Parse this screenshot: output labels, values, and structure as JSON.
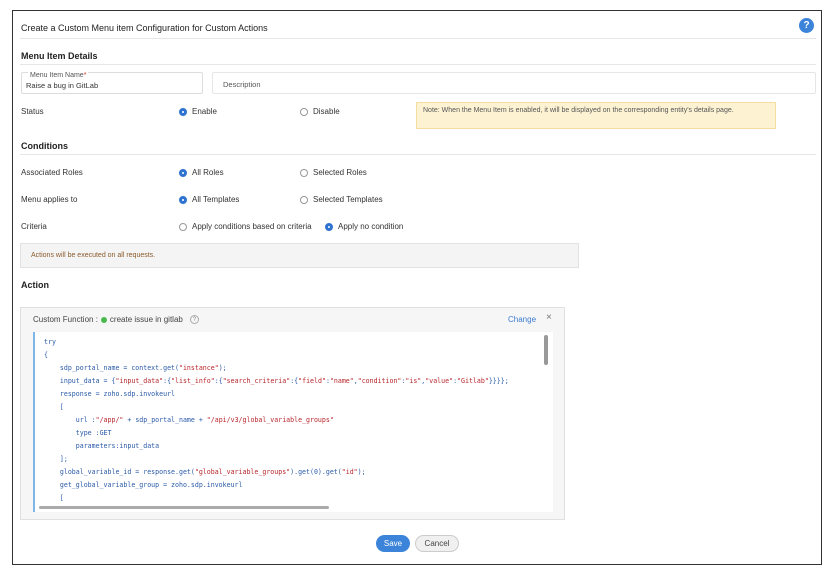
{
  "header": {
    "title": "Create a Custom Menu item Configuration for Custom Actions",
    "help_icon": "?"
  },
  "menu_item_details": {
    "section_title": "Menu Item Details",
    "name_label": "Menu Item Name",
    "name_required": "*",
    "name_value": "Raise a bug in GitLab",
    "description_placeholder": "Description"
  },
  "status": {
    "label": "Status",
    "options": [
      "Enable",
      "Disable"
    ],
    "selected": "Enable",
    "note": "Note: When the Menu Item is enabled, it will be displayed on the corresponding entity's details page."
  },
  "conditions": {
    "section_title": "Conditions",
    "associated_roles": {
      "label": "Associated Roles",
      "options": [
        "All Roles",
        "Selected Roles"
      ],
      "selected": "All Roles"
    },
    "menu_applies_to": {
      "label": "Menu applies to",
      "options": [
        "All Templates",
        "Selected Templates"
      ],
      "selected": "All Templates"
    },
    "criteria": {
      "label": "Criteria",
      "options": [
        "Apply conditions based on criteria",
        "Apply no condition"
      ],
      "selected": "Apply no condition"
    },
    "info": "Actions will be executed on all requests."
  },
  "action": {
    "section_title": "Action",
    "custom_function_label": "Custom Function :",
    "function_name": "create issue in gitlab",
    "status_color": "#4cb84c",
    "change_label": "Change",
    "close_icon": "×",
    "help_icon": "?",
    "code_lines": [
      "try",
      "{",
      "    sdp_portal_name = context.get(\"instance\");",
      "    input_data = {\"input_data\":{\"list_info\":{\"search_criteria\":{\"field\":\"name\",\"condition\":\"is\",\"value\":\"Gitlab\"}}}};",
      "    response = zoho.sdp.invokeurl",
      "    [",
      "        url :\"/app/\" + sdp_portal_name + \"/api/v3/global_variable_groups\"",
      "        type :GET",
      "        parameters:input_data",
      "    ];",
      "    global_variable_id = response.get(\"global_variable_groups\").get(0).get(\"id\");",
      "    get_global_variable_group = zoho.sdp.invokeurl",
      "    ["
    ]
  },
  "footer": {
    "save_label": "Save",
    "cancel_label": "Cancel"
  },
  "colors": {
    "accent": "#3b84d9",
    "note_bg": "#fdf3d3",
    "info_text": "#8a5a2b"
  }
}
